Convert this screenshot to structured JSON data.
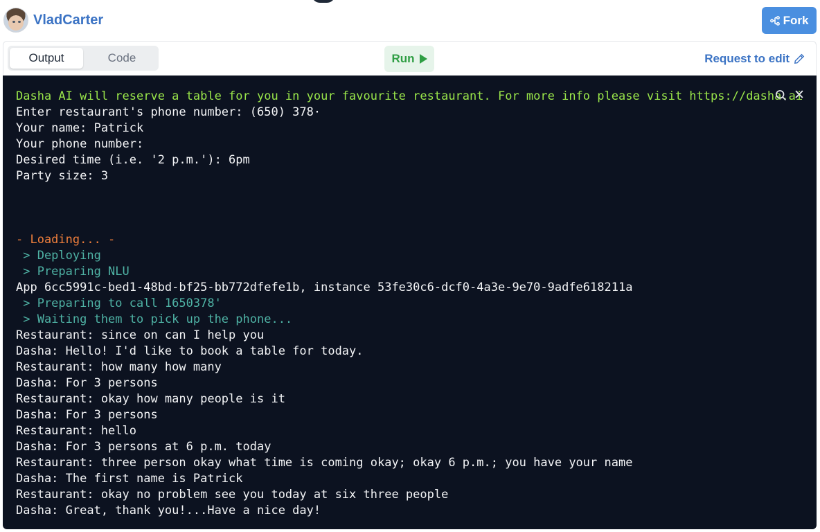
{
  "header": {
    "username": "VladCarter",
    "fork_label": "Fork"
  },
  "toolbar": {
    "tabs": [
      {
        "label": "Output",
        "active": true
      },
      {
        "label": "Code",
        "active": false
      }
    ],
    "run_label": "Run",
    "request_edit_label": "Request to edit"
  },
  "terminal": {
    "lines": [
      {
        "text": "Dasha AI will reserve a table for you in your favourite restaurant. For more info please visit https://dasha.ai",
        "style": "green"
      },
      {
        "text": "Enter restaurant's phone number: (650) 378·",
        "style": "white"
      },
      {
        "text": "Your name: Patrick",
        "style": "white"
      },
      {
        "text": "Your phone number:",
        "style": "white"
      },
      {
        "text": "Desired time (i.e. '2 p.m.'): 6pm",
        "style": "white"
      },
      {
        "text": "Party size: 3",
        "style": "white"
      },
      {
        "text": "",
        "style": "gap"
      },
      {
        "text": "",
        "style": "gap"
      },
      {
        "text": "",
        "style": "gap"
      },
      {
        "text": "- Loading... -",
        "style": "orange"
      },
      {
        "text": " > Deploying",
        "style": "teal"
      },
      {
        "text": " > Preparing NLU",
        "style": "teal"
      },
      {
        "text": "App 6cc5991c-bed1-48bd-bf25-bb772dfefe1b, instance 53fe30c6-dcf0-4a3e-9e70-9adfe618211a",
        "style": "white"
      },
      {
        "text": " > Preparing to call 1650378'",
        "style": "teal"
      },
      {
        "text": " > Waiting them to pick up the phone...",
        "style": "teal"
      },
      {
        "text": "Restaurant: since on can I help you",
        "style": "white"
      },
      {
        "text": "Dasha: Hello! I'd like to book a table for today.",
        "style": "white"
      },
      {
        "text": "Restaurant: how many how many",
        "style": "white"
      },
      {
        "text": "Dasha: For 3 persons",
        "style": "white"
      },
      {
        "text": "Restaurant: okay how many people is it",
        "style": "white"
      },
      {
        "text": "Dasha: For 3 persons",
        "style": "white"
      },
      {
        "text": "Restaurant: hello",
        "style": "white"
      },
      {
        "text": "Dasha: For 3 persons at 6 p.m. today",
        "style": "white"
      },
      {
        "text": "Restaurant: three person okay what time is coming okay; okay 6 p.m.; you have your name",
        "style": "white"
      },
      {
        "text": "Dasha: The first name is Patrick",
        "style": "white"
      },
      {
        "text": "Restaurant: okay no problem see you today at six three people",
        "style": "white"
      },
      {
        "text": "Dasha: Great, thank you!...Have a nice day!",
        "style": "white"
      }
    ]
  },
  "colors": {
    "accent": "#4a8fe0",
    "link": "#3b73c4",
    "run_green": "#2f9e44",
    "terminal_bg": "#0c1220",
    "terminal_green": "#9ae64a",
    "terminal_orange": "#f07f3c",
    "terminal_teal": "#4fb3a5"
  },
  "icons": {
    "fork": "fork-icon",
    "run": "play-icon",
    "edit": "pencil-icon",
    "search": "search-icon",
    "close": "close-icon"
  }
}
